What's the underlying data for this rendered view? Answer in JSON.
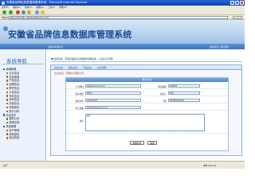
{
  "window": {
    "title": "安徽省品牌信息数据库管理系统 - Microsoft Internet Explorer",
    "menu": [
      "文件(F)",
      "编辑(E)",
      "查看(V)",
      "收藏(A)",
      "工具(T)",
      "帮助(H)"
    ],
    "address_label": "地址(D)",
    "address_value": "http://192.168.1.100/app/MainForm.htm"
  },
  "header": {
    "title": "安徽省品牌信息数据库管理系统",
    "company": "安徽XX有限公司",
    "links": "| 系统首页 | 退出管理"
  },
  "sidebar": {
    "title": "系统导航",
    "items": [
      {
        "label": "品牌管理",
        "type": "group"
      },
      {
        "label": "企业信息",
        "type": "sub"
      },
      {
        "label": "信息管理",
        "type": "sub"
      },
      {
        "label": "产品信息",
        "type": "sub"
      },
      {
        "label": "品牌信息",
        "type": "sub"
      },
      {
        "label": "荣誉信息",
        "type": "sub"
      },
      {
        "label": "认证信息",
        "type": "sub"
      },
      {
        "label": "专利信息",
        "type": "sub"
      },
      {
        "label": "商标信息",
        "type": "sub"
      },
      {
        "label": "质量信息",
        "type": "sub"
      },
      {
        "label": "消费投诉",
        "type": "sub"
      },
      {
        "label": "统计分析",
        "type": "sub"
      },
      {
        "label": "信息发布",
        "type": "group"
      },
      {
        "label": "通知公告",
        "type": "sub"
      },
      {
        "label": "政策法规",
        "type": "sub"
      },
      {
        "label": "系统管理",
        "type": "group"
      },
      {
        "label": "用户管理",
        "type": "sub"
      },
      {
        "label": "修改密码",
        "type": "sub"
      },
      {
        "label": "退出系统",
        "type": "sub"
      }
    ]
  },
  "breadcrumb": "当前位置：安徽省品牌信息数据库管理系统 > 企业信息管理",
  "panel": {
    "tabs": [
      "企业信息",
      "联系信息",
      "产品信息",
      "信息管理"
    ],
    "title": "企业信息：安徽XX有限公司"
  },
  "form": {
    "heading": "联系方式",
    "fields": {
      "website": {
        "label": "公司网址",
        "value": "www.xxxxx.com.cn"
      },
      "postcode_label": "邮政编码",
      "postcode": "230001",
      "phone": {
        "label": "联系电话",
        "value": "0551-"
      },
      "contact_label": "联系人",
      "contact": "XXX",
      "fax": {
        "label": "联系传真",
        "value": "XXXXXXXX"
      },
      "mobile_label": "手机",
      "mobile": "XXXXXXXXXXX",
      "email": {
        "label": "电子邮箱",
        "value": "xxxxx@xxxxx.com.cn"
      },
      "note": {
        "label": "备注",
        "value": "备注"
      }
    },
    "submit_label": "提交信息",
    "reset_label": "重置"
  },
  "statusbar": {
    "status": "完毕",
    "zone": "本地 Intranet"
  },
  "colors": {
    "banner_title": "#1a4d96",
    "accent_bar": "#3a73bd",
    "required": "#dd0000"
  }
}
